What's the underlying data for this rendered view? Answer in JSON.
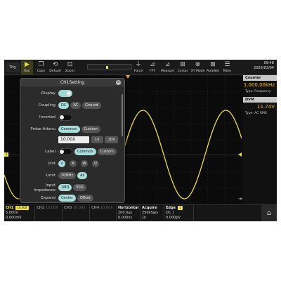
{
  "toolbar": {
    "trigger_mode": "Trig",
    "buttons": [
      {
        "label": "Run",
        "icon": "▶"
      },
      {
        "label": "Copy",
        "icon": "❐"
      },
      {
        "label": "Default",
        "icon": "⟲"
      },
      {
        "label": "Zoom",
        "icon": "⊡"
      },
      {
        "label": "Force",
        "icon": "⏚"
      },
      {
        "label": "FFT",
        "icon": "⊿"
      },
      {
        "label": "Measure",
        "icon": "⊿"
      },
      {
        "label": "Cursor",
        "icon": "⊞"
      },
      {
        "label": "XY Mode",
        "icon": "⊗"
      },
      {
        "label": "AutoSet",
        "icon": "⊠"
      },
      {
        "label": "More",
        "icon": "☰"
      }
    ],
    "time": "09:48",
    "date": "2025/03/04"
  },
  "right_panel": {
    "counter_title": "Counter",
    "counter_value": "1.000,00kHz",
    "counter_type": "Type: Frequency",
    "dvm_title": "DVM",
    "dvm_value": "11.74V",
    "dvm_type": "Type: AC RMS"
  },
  "dialog": {
    "title": "CH1Setting",
    "display_label": "Display",
    "coupling_label": "Coupling",
    "coupling_options": [
      "DC",
      "AC",
      "Ground"
    ],
    "inverted_label": "Inverted",
    "probe_label": "Probe Attenu",
    "probe_options": [
      "Common",
      "Custom"
    ],
    "probe_value": "10.00X",
    "probe_steps": [
      "1X",
      "10X"
    ],
    "label_label": "Label",
    "label_options": [
      "Common",
      "Custom"
    ],
    "unit_label": "Unit",
    "unit_options": [
      "V",
      "A",
      "W",
      "U"
    ],
    "limit_label": "Limit",
    "limit_options": [
      "20MHz",
      "All"
    ],
    "impedance_label_1": "Input",
    "impedance_label_2": "Impedance",
    "impedance_options": [
      "1MΩ",
      "50Ω"
    ],
    "expand_label": "Expand",
    "expand_options": [
      "Center",
      "Offset"
    ]
  },
  "status": {
    "ch1": {
      "name": "CH1",
      "probe": "10.00X",
      "scale": "5.000V",
      "offset": "0.000mV"
    },
    "ch2": {
      "name": "CH2",
      "probe": "10.00X"
    },
    "ch3": {
      "name": "CH3",
      "probe": "10.00X"
    },
    "ch4": {
      "name": "CH4",
      "probe": "10.00X"
    },
    "horizontal": {
      "title": "Horizontal",
      "scale": "200.0μs",
      "pos": "0.000ns"
    },
    "acquire": {
      "title": "Acquire",
      "rate": "250kSa/s",
      "depth": "1k"
    },
    "edge": {
      "title": "Edge",
      "source": "1",
      "coupling": "DC",
      "level": "0.000pV"
    }
  },
  "colors": {
    "waveform": "#e8e040",
    "accent": "#a9ddd7"
  }
}
